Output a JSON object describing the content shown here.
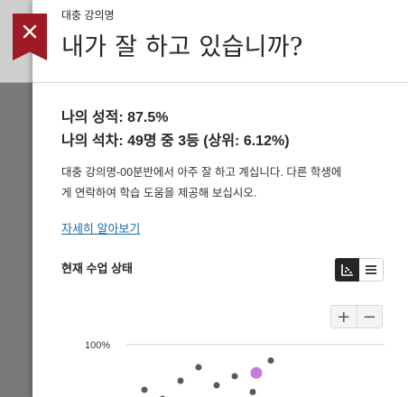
{
  "header": {
    "course_name": "대충 강의명",
    "title": "내가 잘 하고 있습니까?"
  },
  "grade": {
    "score_label": "나의 성적: 87.5%",
    "rank_label": "나의 석차: 49명 중 3등 (상위: 6.12%)"
  },
  "description": "대충 강의명-00분반에서 아주 잘 하고 계십니다. 다른 학생에게 연락하여 학습 도움을 제공해 보십시오.",
  "more_link": "자세히 알아보기",
  "status": {
    "section_title": "현재 수업 상태",
    "view_modes": [
      "chart-icon",
      "list-icon"
    ],
    "active_view": "chart"
  },
  "zoom": {
    "plus": "+",
    "minus": "−"
  },
  "colors": {
    "close_tab": "#a01926",
    "highlight_point": "#c77ddb",
    "other_points": "#5a5a5a"
  },
  "chart_data": {
    "type": "scatter",
    "y_tick_labels": [
      "100%"
    ],
    "series": [
      {
        "name": "",
        "points": [
          {
            "x": 1,
            "y": 80
          },
          {
            "x": 2,
            "y": 76
          },
          {
            "x": 3,
            "y": 84
          },
          {
            "x": 4,
            "y": 90
          },
          {
            "x": 5,
            "y": 82
          },
          {
            "x": 6,
            "y": 86
          },
          {
            "x": 7,
            "y": 79
          },
          {
            "x": 8,
            "y": 93
          }
        ]
      },
      {
        "name": "",
        "highlight": true,
        "points": [
          {
            "x": 7.2,
            "y": 87.5
          }
        ]
      }
    ]
  }
}
